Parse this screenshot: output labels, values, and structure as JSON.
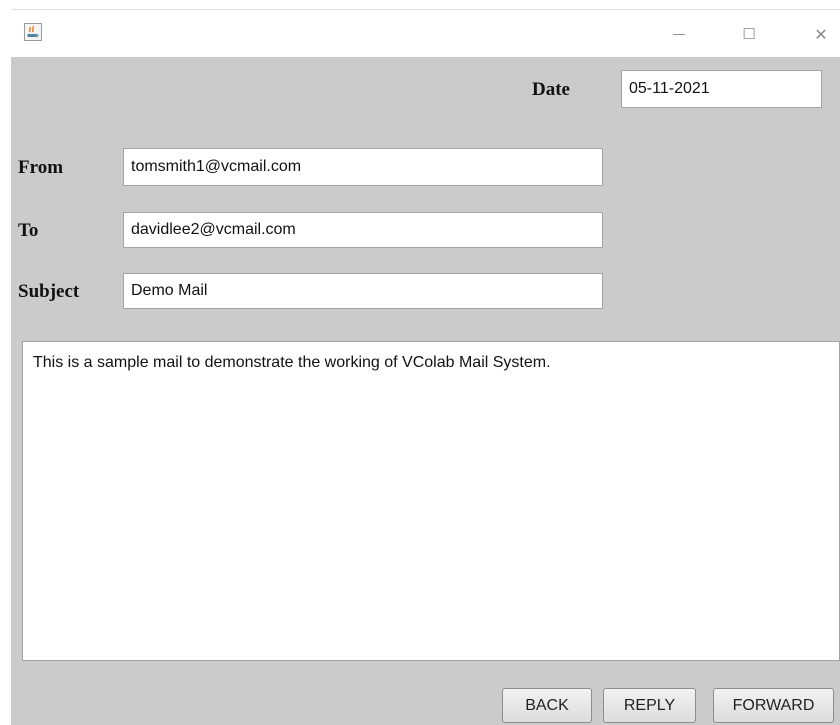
{
  "window": {
    "app_icon": "java-icon",
    "minimize_icon": "minimize-icon",
    "maximize_icon": "maximize-icon",
    "close_icon": "close-icon",
    "minimize_glyph": "—",
    "maximize_glyph": "☐",
    "close_glyph": "✕"
  },
  "mail": {
    "date_label": "Date",
    "date_value": "05-11-2021",
    "from_label": "From",
    "from_value": "tomsmith1@vcmail.com",
    "to_label": "To",
    "to_value": "davidlee2@vcmail.com",
    "subject_label": "Subject",
    "subject_value": "Demo Mail",
    "body": "This is a sample mail to demonstrate the working of VColab Mail System."
  },
  "buttons": {
    "back": "BACK",
    "reply": "REPLY",
    "forward": "FORWARD"
  }
}
